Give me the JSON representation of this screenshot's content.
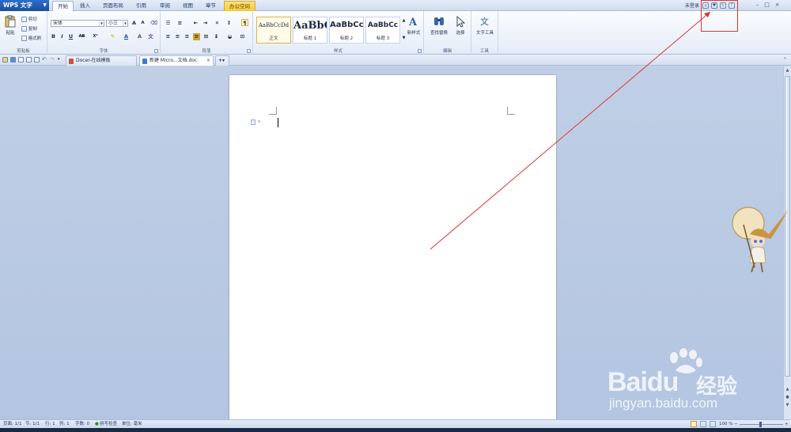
{
  "app": {
    "name": "WPS 文字",
    "menu_tabs": [
      "开始",
      "插入",
      "页面布局",
      "引用",
      "审阅",
      "视图",
      "章节",
      "办公空间"
    ],
    "login_label": "未登录"
  },
  "ribbon": {
    "clipboard": {
      "paste": "粘贴",
      "cut": "剪切",
      "copy": "复制",
      "format_painter": "格式刷",
      "label": "剪贴板"
    },
    "font": {
      "font_name": "宋体",
      "font_size": "小三",
      "label": "字体",
      "bold": "B",
      "italic": "I",
      "underline": "U",
      "strike": "AB",
      "superscript": "X²"
    },
    "paragraph": {
      "label": "段落"
    },
    "styles": {
      "label": "样式",
      "items": [
        {
          "sample": "AaBbCcDd",
          "name": "正文"
        },
        {
          "sample": "AaBbC",
          "name": "标题 1"
        },
        {
          "sample": "AaBbCc",
          "name": "标题 2"
        },
        {
          "sample": "AaBbCc",
          "name": "标题 3"
        }
      ],
      "new_style": "新样式"
    },
    "editing": {
      "find_replace": "查找替换",
      "select": "选择",
      "label": "编辑"
    },
    "tools": {
      "text_tools": "文字工具",
      "label": "工具"
    }
  },
  "doc_tabs": [
    {
      "title": "Docer-在线模板"
    },
    {
      "title": "新建 Micro...文档.doc"
    }
  ],
  "status": {
    "page": "页面: 1/1",
    "section": "节: 1/1",
    "line": "行: 1",
    "column": "列: 1",
    "word_count": "字数: 0",
    "spell_check": "拼写检查",
    "unit": "单位: 毫米",
    "zoom": "100 %"
  },
  "watermark": {
    "brand": "Baidu",
    "cn": "经验",
    "url": "jingyan.baidu.com"
  },
  "colors": {
    "accent": "#1a4ea0",
    "annotation": "#e03131",
    "ribbon_bg": "#fbfdff"
  }
}
